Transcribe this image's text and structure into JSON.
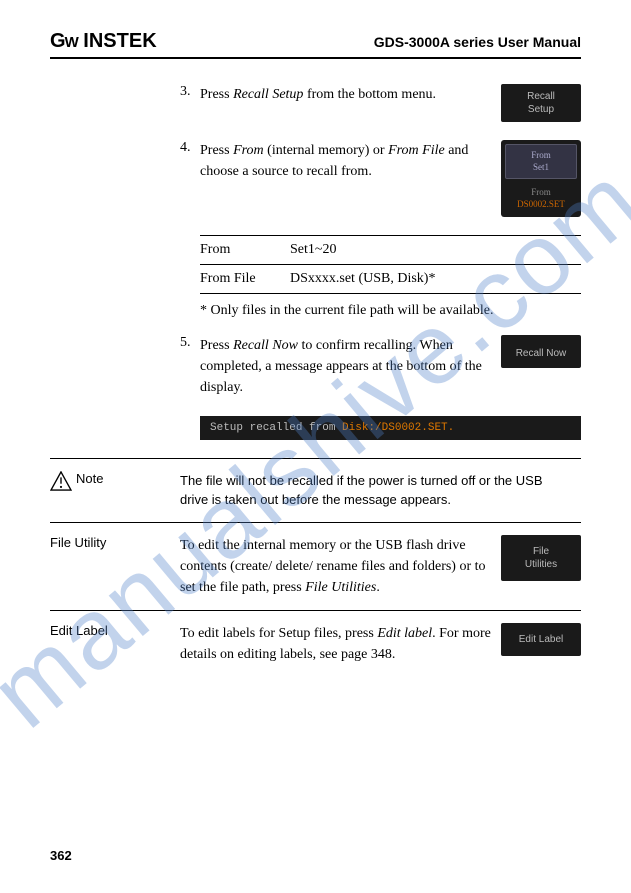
{
  "header": {
    "logo": "GW INSTEK",
    "title": "GDS-3000A series User Manual"
  },
  "steps": {
    "s3": {
      "num": "3.",
      "text_a": "Press ",
      "text_em": "Recall Setup",
      "text_b": " from the bottom menu.",
      "btn": "Recall\nSetup"
    },
    "s4": {
      "num": "4.",
      "text_a": "Press ",
      "text_em1": "From",
      "text_b": " (internal memory) or ",
      "text_em2": "From File",
      "text_c": " and choose a source to recall from.",
      "btn_top_l1": "From",
      "btn_top_l2": "Set1",
      "btn_bot_l1": "From",
      "btn_bot_l2": "DS0002.SET"
    },
    "table": {
      "r1_label": "From",
      "r1_val": "Set1~20",
      "r2_label": "From File",
      "r2_val": "DSxxxx.set (USB, Disk)*",
      "footnote": "* Only files in the current file path will be available."
    },
    "s5": {
      "num": "5.",
      "text_a": "Press ",
      "text_em": "Recall Now",
      "text_b": " to confirm recalling. When completed, a message appears at the bottom of the display.",
      "btn": "Recall Now",
      "status_a": "Setup recalled from ",
      "status_b": "Disk:/DS0002.SET."
    }
  },
  "sections": {
    "note": {
      "label": "Note",
      "text": "The file will not be recalled if the power is turned off or the USB drive is taken out before the message appears."
    },
    "file_utility": {
      "label": "File Utility",
      "text_a": "To edit the internal memory or the USB flash drive contents (create/ delete/ rename files and folders) or to set the file path, press ",
      "text_em": "File Utilities",
      "text_b": ".",
      "btn": "File\nUtilities"
    },
    "edit_label": {
      "label": "Edit Label",
      "text_a": "To edit labels for Setup files, press ",
      "text_em": "Edit label",
      "text_b": ". For more details on editing labels, see page 348.",
      "btn": "Edit Label"
    }
  },
  "page": "362",
  "watermark": "manualshive.com"
}
